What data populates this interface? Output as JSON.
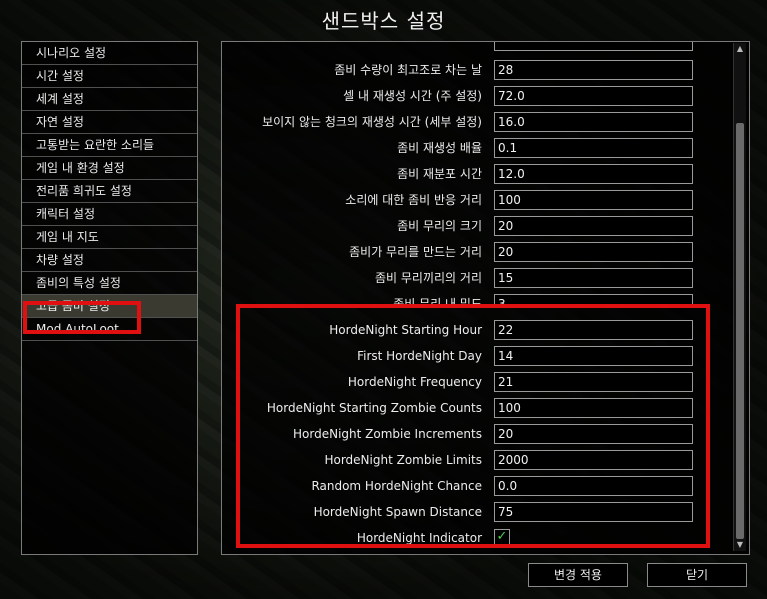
{
  "title": "샌드박스 설정",
  "sidebar": {
    "items": [
      {
        "label": "시나리오 설정"
      },
      {
        "label": "시간 설정"
      },
      {
        "label": "세계 설정"
      },
      {
        "label": "자연 설정"
      },
      {
        "label": "고통받는 요란한 소리들"
      },
      {
        "label": "게임 내 환경 설정"
      },
      {
        "label": "전리품 희귀도 설정"
      },
      {
        "label": "캐릭터 설정"
      },
      {
        "label": "게임 내 지도"
      },
      {
        "label": "차량 설정"
      },
      {
        "label": "좀비의 특성 설정"
      },
      {
        "label": "고급 좀비 설정"
      },
      {
        "label": "Mod AutoLoot"
      }
    ],
    "selected": "고급 좀비 설정"
  },
  "settings": [
    {
      "label": "좀비 수량이 최고조로 차는 날",
      "value": "28"
    },
    {
      "label": "셀 내 재생성 시간 (주 설정)",
      "value": "72.0"
    },
    {
      "label": "보이지 않는 청크의 재생성 시간 (세부 설정)",
      "value": "16.0"
    },
    {
      "label": "좀비 재생성 배율",
      "value": "0.1"
    },
    {
      "label": "좀비 재분포 시간",
      "value": "12.0"
    },
    {
      "label": "소리에 대한 좀비 반응 거리",
      "value": "100"
    },
    {
      "label": "좀비 무리의 크기",
      "value": "20"
    },
    {
      "label": "좀비가 무리를 만드는 거리",
      "value": "20"
    },
    {
      "label": "좀비 무리끼리의 거리",
      "value": "15"
    },
    {
      "label": "좀비 무리 내 밀도",
      "value": "3"
    },
    {
      "label": "HordeNight Starting Hour",
      "value": "22"
    },
    {
      "label": "First HordeNight Day",
      "value": "14"
    },
    {
      "label": "HordeNight Frequency",
      "value": "21"
    },
    {
      "label": "HordeNight Starting Zombie Counts",
      "value": "100"
    },
    {
      "label": "HordeNight Zombie Increments",
      "value": "20"
    },
    {
      "label": "HordeNight Zombie Limits",
      "value": "2000"
    },
    {
      "label": "Random HordeNight Chance",
      "value": "0.0"
    },
    {
      "label": "HordeNight Spawn Distance",
      "value": "75"
    },
    {
      "label": "HordeNight Indicator",
      "checked": true,
      "check_glyph": "✓"
    }
  ],
  "scroll": {
    "up_glyph": "▲",
    "down_glyph": "▼"
  },
  "buttons": {
    "apply": "변경 적용",
    "close": "닫기"
  },
  "colors": {
    "highlight": "#e01010",
    "check": "#4ad04a"
  }
}
